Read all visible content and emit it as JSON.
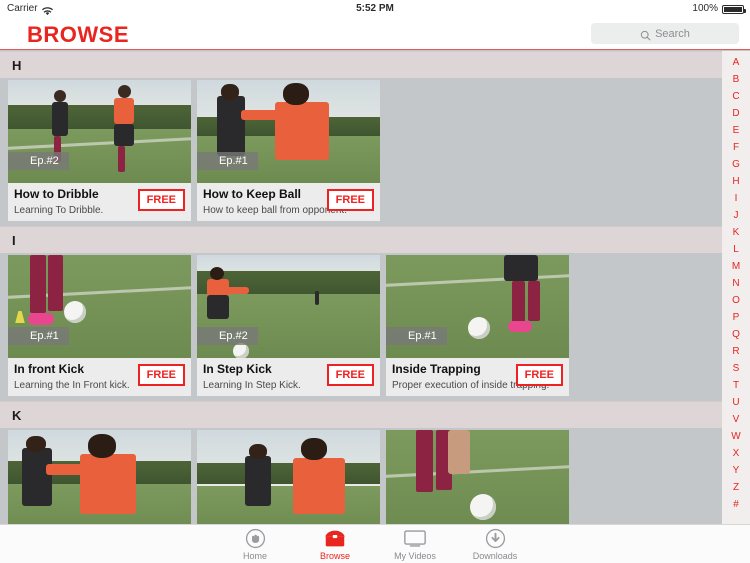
{
  "status_bar": {
    "carrier": "Carrier",
    "wifi_icon": "wifi-icon",
    "time": "5:52 PM",
    "battery_percent": "100%",
    "battery_icon": "battery-full-icon"
  },
  "nav": {
    "title": "BROWSE",
    "accent_color": "#e8251f",
    "search": {
      "placeholder": "Search",
      "value": "",
      "icon": "search-icon"
    }
  },
  "sections": [
    {
      "letter": "H",
      "cards": [
        {
          "episode": "Ep.#2",
          "title": "How to Dribble",
          "subtitle": "Learning To Dribble.",
          "badge": "FREE"
        },
        {
          "episode": "Ep.#1",
          "title": "How to Keep Ball",
          "subtitle": "How to keep ball from opponent.",
          "badge": "FREE"
        }
      ]
    },
    {
      "letter": "I",
      "cards": [
        {
          "episode": "Ep.#1",
          "title": "In front Kick",
          "subtitle": "Learning the In Front kick.",
          "badge": "FREE"
        },
        {
          "episode": "Ep.#2",
          "title": "In Step Kick",
          "subtitle": "Learning In Step Kick.",
          "badge": "FREE"
        },
        {
          "episode": "Ep.#1",
          "title": "Inside Trapping",
          "subtitle": "Proper execution of inside trapping.",
          "badge": "FREE"
        }
      ]
    },
    {
      "letter": "K",
      "cards": [
        {
          "episode": "",
          "title": "",
          "subtitle": "",
          "badge": ""
        },
        {
          "episode": "",
          "title": "",
          "subtitle": "",
          "badge": ""
        },
        {
          "episode": "",
          "title": "",
          "subtitle": "",
          "badge": ""
        }
      ]
    }
  ],
  "index_bar": {
    "letters": [
      "A",
      "B",
      "C",
      "D",
      "E",
      "F",
      "G",
      "H",
      "I",
      "J",
      "K",
      "L",
      "M",
      "N",
      "O",
      "P",
      "Q",
      "R",
      "S",
      "T",
      "U",
      "V",
      "W",
      "X",
      "Y",
      "Z",
      "#"
    ],
    "color": "#e8251f"
  },
  "tab_bar": {
    "active": "Browse",
    "active_color": "#e8251f",
    "inactive_color": "#8a8a8f",
    "tabs": [
      {
        "label": "Home",
        "icon": "fist-circle-icon"
      },
      {
        "label": "Browse",
        "icon": "open-box-icon"
      },
      {
        "label": "My Videos",
        "icon": "tv-monitor-icon"
      },
      {
        "label": "Downloads",
        "icon": "download-circle-icon"
      }
    ]
  }
}
